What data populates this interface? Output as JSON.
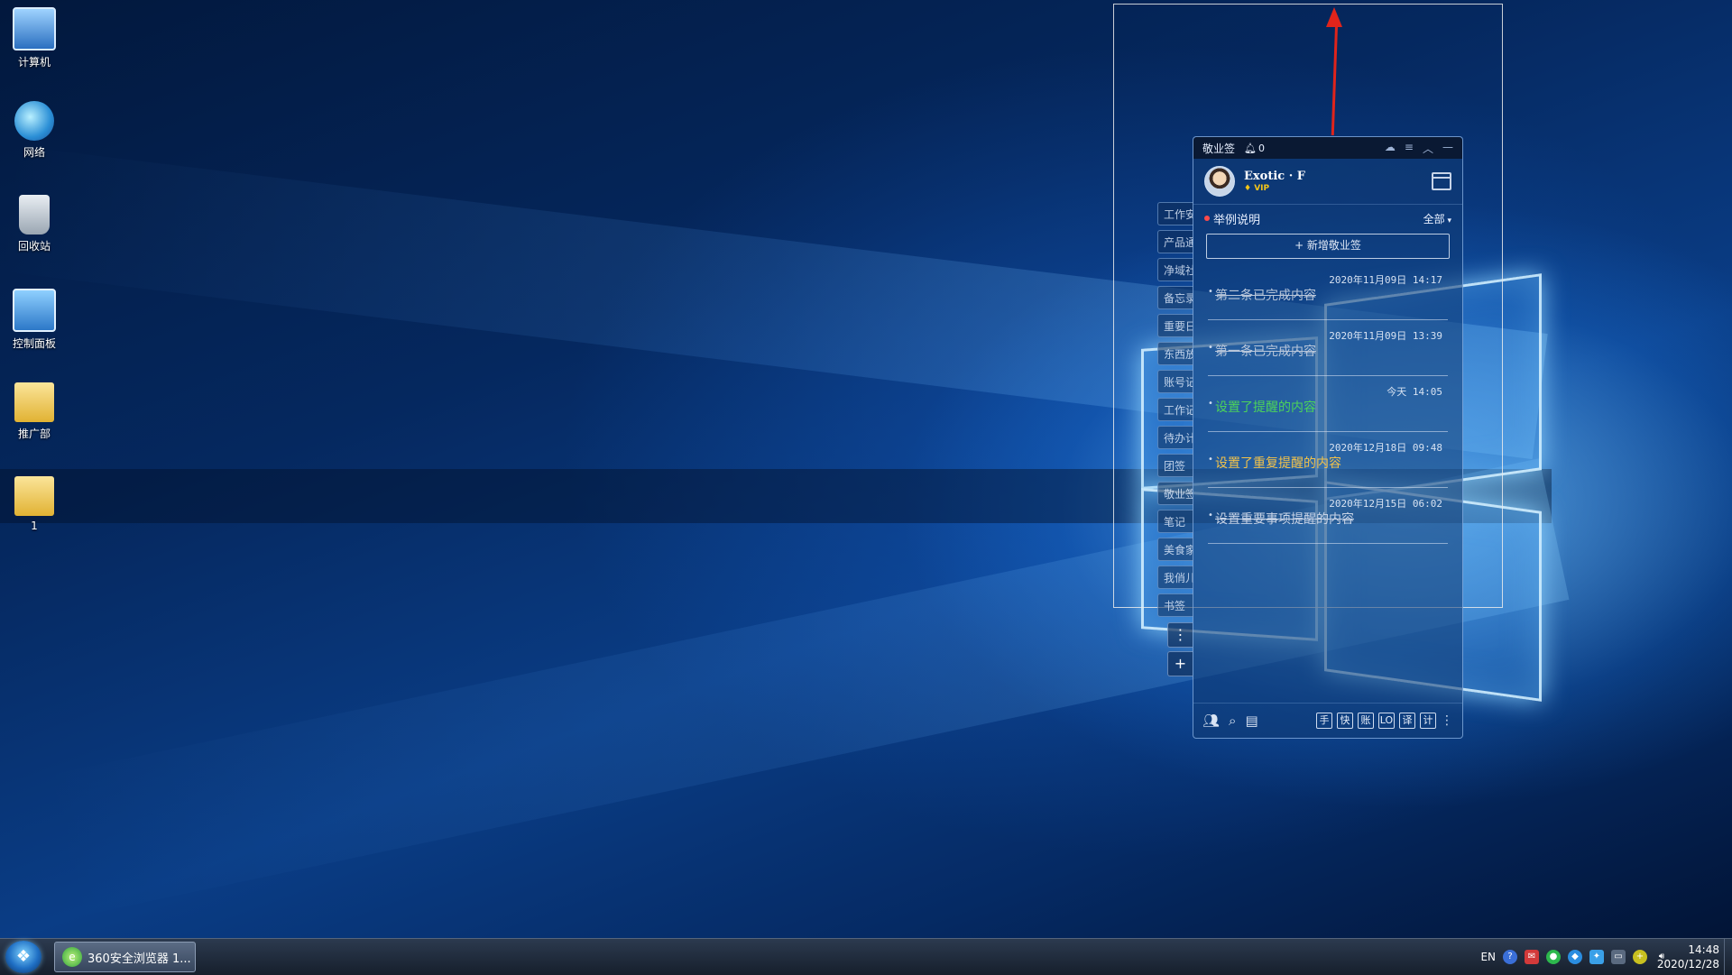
{
  "desktop": {
    "icons": [
      {
        "label": "计算机",
        "icon": "computer-icon"
      },
      {
        "label": "网络",
        "icon": "network-icon"
      },
      {
        "label": "回收站",
        "icon": "recycle-bin-icon"
      },
      {
        "label": "控制面板",
        "icon": "control-panel-icon"
      },
      {
        "label": "推广部",
        "icon": "folder-user-icon"
      },
      {
        "label": "1",
        "icon": "folder-icon"
      }
    ]
  },
  "note_app": {
    "title": "敬业签",
    "notification_count": "0",
    "user": {
      "name": "Exotic · F",
      "badge": "VIP"
    },
    "list_title": "举例说明",
    "filter_label": "全部",
    "add_button_label": "+ 新增敬业签",
    "side_tabs": [
      "工作安排",
      "产品通知",
      "净域社",
      "备忘录",
      "重要日",
      "东西放",
      "账号记",
      "工作记",
      "待办计",
      "团签",
      "敬业签",
      "笔记",
      "美食家",
      "我俏儿",
      "书签"
    ],
    "notes": [
      {
        "time": "2020年11月09日 14:17",
        "text": "第二条已完成内容",
        "style": "done"
      },
      {
        "time": "2020年11月09日 13:39",
        "text": "第一条已完成内容",
        "style": "done"
      },
      {
        "time": "今天 14:05",
        "text": "设置了提醒的内容",
        "style": "green"
      },
      {
        "time": "2020年12月18日 09:48",
        "text": "设置了重复提醒的内容",
        "style": "yellow"
      },
      {
        "time": "2020年12月15日 06:02",
        "text": "设置重要事项提醒的内容",
        "style": "important"
      }
    ],
    "bottom_tools": [
      "手",
      "快",
      "账",
      "LO",
      "译",
      "计"
    ],
    "colors": {
      "accent_red": "#ff4a4a",
      "remind_green": "#4cd35a",
      "repeat_yellow": "#f2c24b",
      "vip_gold": "#f5c518"
    }
  },
  "taskbar": {
    "task_label": "360安全浏览器 1...",
    "language": "EN",
    "clock_time": "14:48",
    "clock_date": "2020/12/28"
  }
}
